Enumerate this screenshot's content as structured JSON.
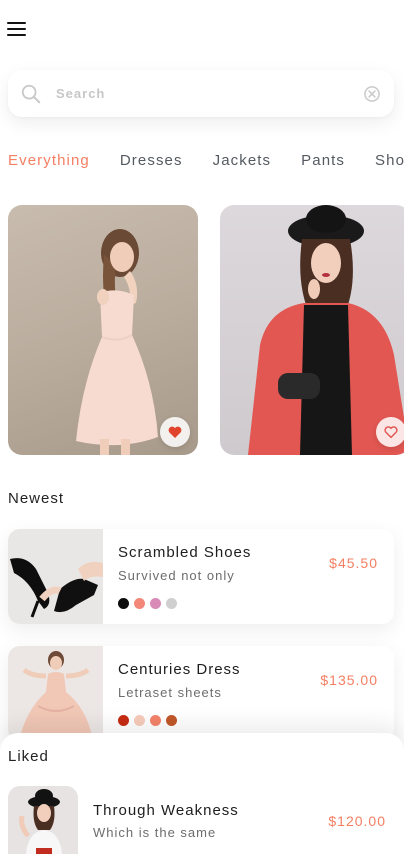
{
  "header": {
    "menu_icon": "hamburger-menu-icon"
  },
  "search": {
    "placeholder": "Search",
    "value": "",
    "search_icon": "search-icon",
    "clear_icon": "clear-circle-icon"
  },
  "categories": [
    {
      "label": "Everything",
      "active": true
    },
    {
      "label": "Dresses",
      "active": false
    },
    {
      "label": "Jackets",
      "active": false
    },
    {
      "label": "Pants",
      "active": false
    },
    {
      "label": "Shoes",
      "active": false
    }
  ],
  "featured": [
    {
      "image": "woman-in-pink-dress-photo",
      "favorited": true
    },
    {
      "image": "woman-in-red-coat-hat-photo",
      "favorited": false
    }
  ],
  "newest": {
    "title": "Newest",
    "items": [
      {
        "name": "Scrambled Shoes",
        "subtitle": "Survived not only",
        "price": "$45.50",
        "image": "black-heels-photo",
        "colors": [
          "#0c0c0c",
          "#f2877a",
          "#d98ab7",
          "#cfcfcf"
        ]
      },
      {
        "name": "Centuries Dress",
        "subtitle": "Letraset sheets",
        "price": "$135.00",
        "image": "pink-dress-photo",
        "colors": [
          "#c62b13",
          "#f7cbbb",
          "#f4836a",
          "#c0582a"
        ]
      }
    ]
  },
  "liked": {
    "title": "Liked",
    "items": [
      {
        "name": "Through Weakness",
        "subtitle": "Which is the same",
        "price": "$120.00",
        "image": "woman-in-hat-photo"
      }
    ]
  },
  "colors": {
    "accent": "#f47f63",
    "heart": "#e0442c",
    "text": "#1e1e1e",
    "muted": "#6d6d6d"
  }
}
